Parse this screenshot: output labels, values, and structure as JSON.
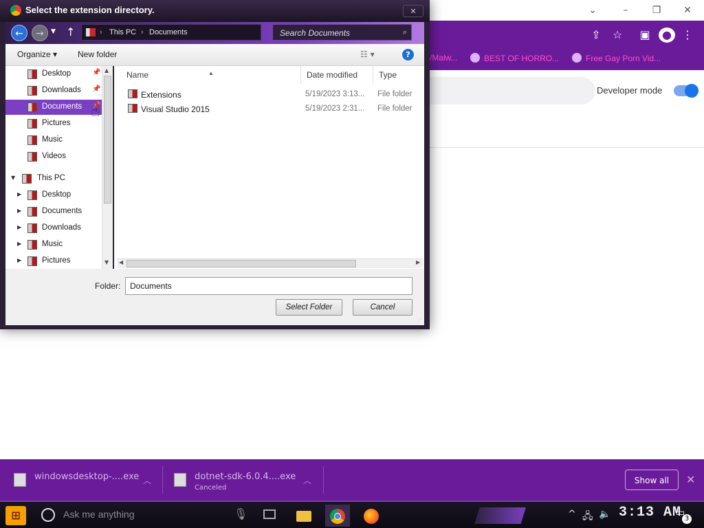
{
  "browser": {
    "bookmarks": [
      {
        "label": "/Malw..."
      },
      {
        "label": "BEST OF HORRO..."
      },
      {
        "label": "Free Gay Porn Vid..."
      }
    ],
    "developer_mode_label": "Developer mode",
    "developer_mode_on": true
  },
  "dialog": {
    "title": "Select the extension directory.",
    "close_glyph": "✕",
    "breadcrumb": [
      "This PC",
      "Documents"
    ],
    "search_placeholder": "Search Documents",
    "organize_label": "Organize ▾",
    "new_folder_label": "New folder",
    "help_glyph": "?",
    "nav_items": [
      {
        "label": "Desktop",
        "pinned": true
      },
      {
        "label": "Downloads",
        "pinned": true
      },
      {
        "label": "Documents",
        "pinned": true,
        "selected": true
      },
      {
        "label": "Pictures",
        "pinned": true
      },
      {
        "label": "Music"
      },
      {
        "label": "Videos"
      },
      {
        "label": "This PC",
        "expanded": true
      },
      {
        "label": "Desktop"
      },
      {
        "label": "Documents"
      },
      {
        "label": "Downloads"
      },
      {
        "label": "Music"
      },
      {
        "label": "Pictures"
      }
    ],
    "columns": {
      "name": "Name",
      "date": "Date modified",
      "type": "Type"
    },
    "files": [
      {
        "name": "Extensions",
        "date": "5/19/2023 3:13...",
        "type": "File folder"
      },
      {
        "name": "Visual Studio 2015",
        "date": "5/19/2023 2:31...",
        "type": "File folder"
      }
    ],
    "folder_label": "Folder:",
    "folder_value": "Documents",
    "select_button": "Select Folder",
    "cancel_button": "Cancel"
  },
  "downloads": {
    "items": [
      {
        "name": "windowsdesktop-....exe",
        "status": ""
      },
      {
        "name": "dotnet-sdk-6.0.4....exe",
        "status": "Canceled"
      }
    ],
    "show_all": "Show all"
  },
  "taskbar": {
    "search_placeholder": "Ask me anything",
    "clock": "3:13 AM",
    "notification_count": "3"
  },
  "colors": {
    "accent_purple": "#6a1b9a",
    "selection": "#7b3fc4",
    "toggle_blue": "#1a73e8"
  }
}
